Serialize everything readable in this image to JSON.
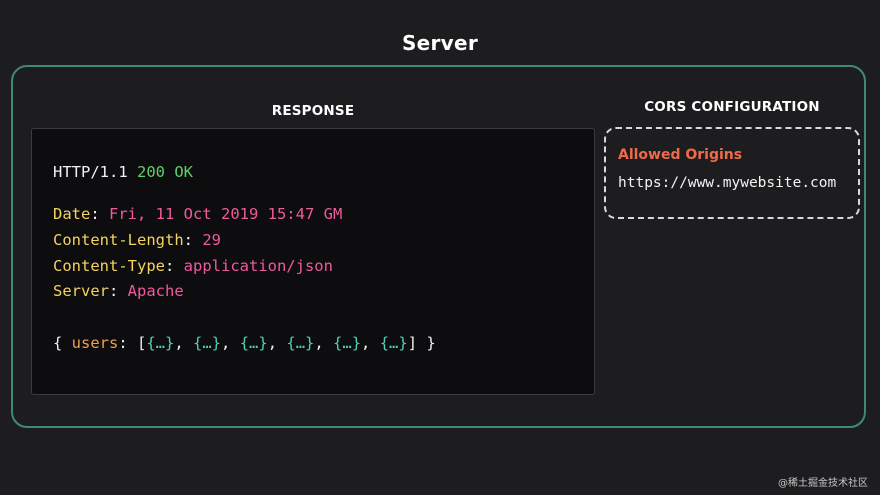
{
  "title": "Server",
  "response": {
    "title": "RESPONSE",
    "status": {
      "protocol": "HTTP/1.1",
      "code": "200 OK"
    },
    "headers": [
      {
        "key": "Date",
        "value": "Fri, 11 Oct 2019 15:47 GM"
      },
      {
        "key": "Content-Length",
        "value": "29"
      },
      {
        "key": "Content-Type",
        "value": "application/json"
      },
      {
        "key": "Server",
        "value": "Apache"
      }
    ],
    "body": {
      "open": "{ ",
      "key": "users",
      "colon": ": [",
      "items": [
        "{…}",
        "{…}",
        "{…}",
        "{…}",
        "{…}",
        "{…}"
      ],
      "separator": ", ",
      "close": "] }"
    }
  },
  "cors": {
    "title": "CORS CONFIGURATION",
    "allowed_origins_label": "Allowed Origins",
    "allowed_origins_value": "https://www.mywebsite.com"
  },
  "watermark": "@稀土掘金技术社区",
  "colors": {
    "border": "#3d8a77",
    "status_ok": "#5fd068",
    "header_key": "#f4d35e",
    "header_value": "#ef5a9c",
    "body_key": "#f0a04b",
    "body_item": "#4fd1b7",
    "allowed_label": "#ef6a4a"
  }
}
